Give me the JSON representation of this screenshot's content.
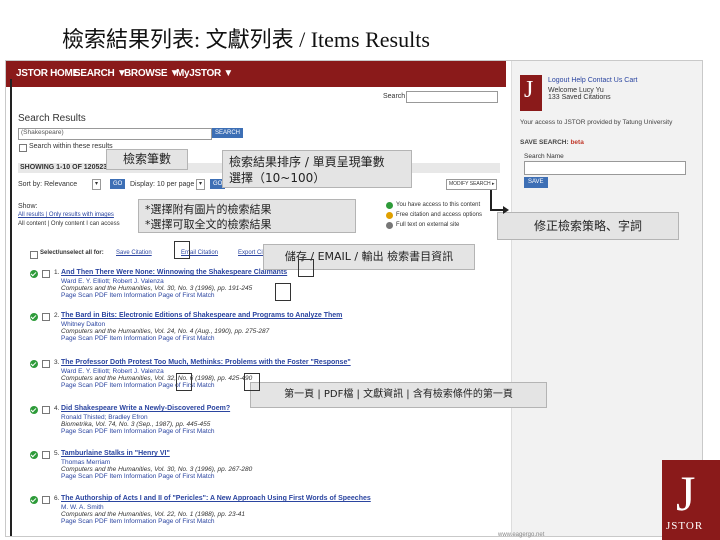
{
  "slide": {
    "title": "檢索結果列表: 文獻列表 / Items Results"
  },
  "nav": {
    "items": [
      "JSTOR HOME",
      "SEARCH ▼",
      "BROWSE ▼",
      "MyJSTOR ▼"
    ]
  },
  "header_right": {
    "links": "Logout   Help   Contact Us   Cart",
    "welcome": "Welcome Lucy Yu",
    "saved_citations": "133 Saved Citations",
    "access": "Your access to JSTOR provided by Tatung University",
    "saved_search_label": "SAVE SEARCH:",
    "beta": "beta",
    "search_name": "Search Name",
    "save_button": "SAVE"
  },
  "search": {
    "label": "Search",
    "heading": "Search Results",
    "query": "(Shakespeare)",
    "search_button": "SEARCH",
    "within": "Search within these results",
    "showing": "SHOWING 1-10 OF 120523",
    "sort_label": "Sort by: Relevance",
    "display_label": "Display: 10 per page",
    "go": "GO",
    "modify": "MODIFY SEARCH ▸"
  },
  "show": {
    "label": "Show:",
    "line1": "All results | Only results with images",
    "line2": "All content | Only content I can access"
  },
  "legend": {
    "l1": "You have access to this content",
    "l2": "Free citation and access options",
    "l3": "Full text on external site"
  },
  "actions": {
    "select_all": "Select/unselect all for:",
    "save": "Save Citation",
    "email": "Email Citation",
    "export": "Export Citation"
  },
  "results": [
    {
      "n": "1.",
      "title": "And Then There Were None: Winnowing the Shakespeare Claimants",
      "authors": "Ward E. Y. Elliott; Robert J. Valenza",
      "source": "Computers and the Humanities, Vol. 30, No. 3 (1996), pp. 191-245",
      "links": "Page Scan   PDF   Item Information   Page of First Match"
    },
    {
      "n": "2.",
      "title": "The Bard in Bits: Electronic Editions of Shakespeare and Programs to Analyze Them",
      "authors": "Whitney Dalton",
      "source": "Computers and the Humanities, Vol. 24, No. 4 (Aug., 1990), pp. 275-287",
      "links": "Page Scan   PDF   Item Information   Page of First Match"
    },
    {
      "n": "3.",
      "title": "The Professor Doth Protest Too Much, Methinks: Problems with the Foster \"Response\"",
      "authors": "Ward E. Y. Elliott; Robert J. Valenza",
      "source": "Computers and the Humanities, Vol. 32, No. 6 (1998), pp. 425-490",
      "links": "Page Scan   PDF   Item Information   Page of First Match"
    },
    {
      "n": "4.",
      "title": "Did Shakespeare Write a Newly-Discovered Poem?",
      "authors": "Ronald Thisted; Bradley Efron",
      "source": "Biometrika, Vol. 74, No. 3 (Sep., 1987), pp. 445-455",
      "links": "Page Scan   PDF   Item Information   Page of First Match"
    },
    {
      "n": "5.",
      "title": "Tamburlaine Stalks in \"Henry VI\"",
      "authors": "Thomas Merriam",
      "source": "Computers and the Humanities, Vol. 30, No. 3 (1996), pp. 267-280",
      "links": "Page Scan   PDF   Item Information   Page of First Match"
    },
    {
      "n": "6.",
      "title": "The Authorship of Acts I and II of \"Pericles\": A New Approach Using First Words of Speeches",
      "authors": "M. W. A. Smith",
      "source": "Computers and the Humanities, Vol. 22, No. 1 (1988), pp. 23-41",
      "links": "Page Scan   PDF   Item Information   Page of First Match"
    }
  ],
  "annotations": {
    "count": "檢索筆數",
    "sort_line1": "檢索結果排序 / 單頁呈現筆數",
    "sort_line2": "選擇（10~100）",
    "filter_line1": "*選擇附有圖片的檢索結果",
    "filter_line2": "*選擇可取全文的檢索結果",
    "modify": "修正檢索策略、字詞",
    "export": "儲存 / EMAIL / 輸出 檢索書目資訊",
    "links": "第一頁 | PDF檔 | 文獻資訊 | 含有檢索條件的第一頁"
  },
  "footer": {
    "url": "www.eagergo.net"
  },
  "colors": {
    "jstor_red": "#8a1a1a",
    "link_blue": "#2b45a0",
    "access_green": "#2e9b3a"
  }
}
